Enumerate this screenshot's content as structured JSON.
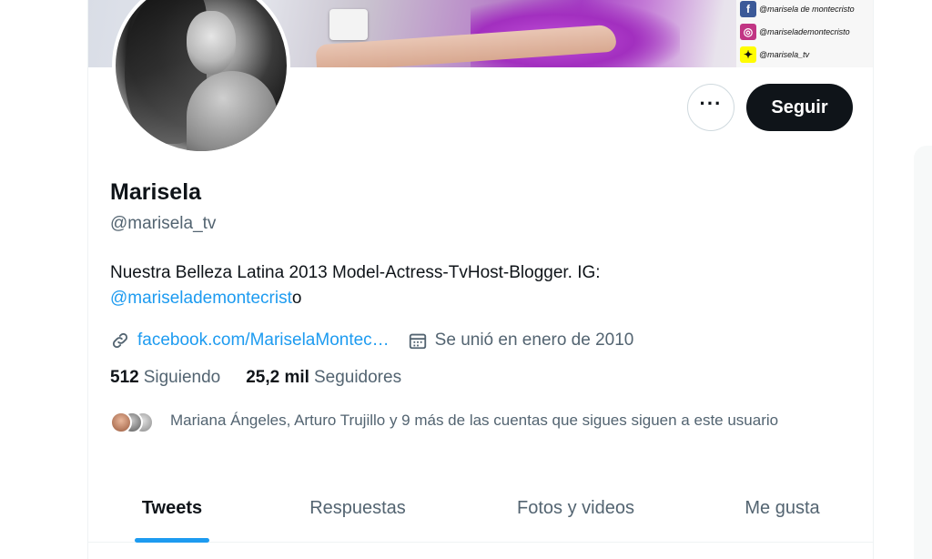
{
  "banner": {
    "social_links": [
      {
        "icon": "facebook-icon",
        "glyph": "f",
        "color": "#3b5998",
        "text": "@marisela de montecristo"
      },
      {
        "icon": "instagram-icon",
        "glyph": "◎",
        "color": "#c13584",
        "text": "@mariselademontecristo"
      },
      {
        "icon": "snapchat-icon",
        "glyph": "✦",
        "color": "#fffc00",
        "text": "@marisela_tv"
      }
    ]
  },
  "actions": {
    "more_glyph": "···",
    "follow_label": "Seguir"
  },
  "profile": {
    "name": "Marisela",
    "handle": "@marisela_tv",
    "bio_text": "Nuestra Belleza Latina 2013 Model-Actress-TvHost-Blogger. IG: ",
    "bio_mention": "@mariselademontecrist",
    "bio_tail": "o",
    "link": "facebook.com/MariselaMontec…",
    "joined": "Se unió en enero de 2010"
  },
  "stats": {
    "following_count": "512",
    "following_label": "Siguiendo",
    "followers_count": "25,2 mil",
    "followers_label": "Seguidores"
  },
  "followers_you_know": "Mariana Ángeles, Arturo Trujillo y 9 más de las cuentas que sigues siguen a este usuario",
  "tabs": [
    {
      "label": "Tweets",
      "active": true
    },
    {
      "label": "Respuestas",
      "active": false
    },
    {
      "label": "Fotos y videos",
      "active": false
    },
    {
      "label": "Me gusta",
      "active": false
    }
  ],
  "colors": {
    "accent": "#1d9bf0",
    "text_primary": "#0f1419",
    "text_secondary": "#536471"
  }
}
